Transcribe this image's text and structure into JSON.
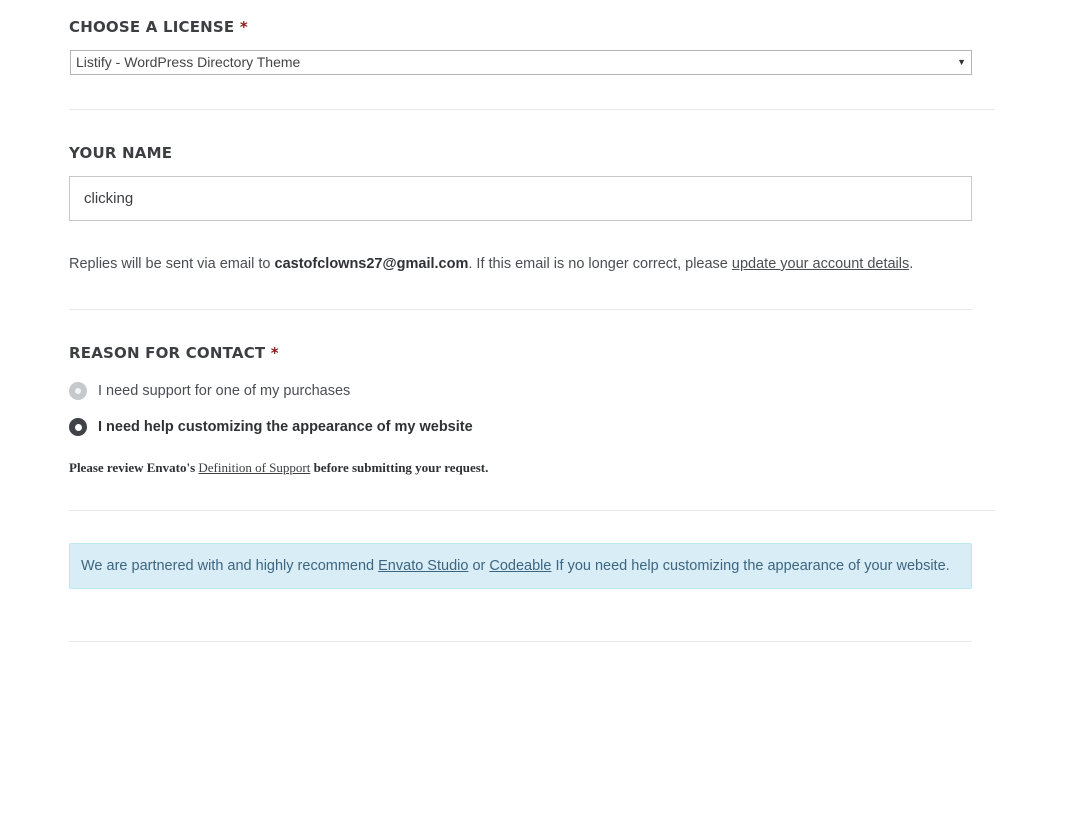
{
  "license": {
    "label": "CHOOSE A LICENSE",
    "required_mark": "*",
    "selected": "Listify - WordPress Directory Theme",
    "arrow_icon": "triangle-down-icon"
  },
  "name": {
    "label": "YOUR NAME",
    "value": "clicking",
    "placeholder": ""
  },
  "reply": {
    "prefix": "Replies will be sent via email to ",
    "email": "castofclowns27@gmail.com",
    "middle": ". If this email is no longer correct, please ",
    "link": "update your account details",
    "suffix": "."
  },
  "reason": {
    "label": "REASON FOR CONTACT",
    "required_mark": "*",
    "options": [
      {
        "label": "I need support for one of my purchases",
        "selected": false
      },
      {
        "label": "I need help customizing the appearance of my website",
        "selected": true
      }
    ]
  },
  "review": {
    "prefix": "Please review Envato's ",
    "link": "Definition of Support",
    "suffix": " before submitting your request."
  },
  "partner": {
    "prefix": "We are partnered with and highly recommend ",
    "link1": "Envato Studio",
    "middle": " or ",
    "link2": "Codeable",
    "suffix": " If you need help customizing the appearance of your website."
  },
  "colors": {
    "required": "#8c1b1b",
    "info_bg": "#d9edf7",
    "info_text": "#3d6580",
    "radio_selected": "#3f4246",
    "radio_unselected": "#c6c9cc"
  }
}
